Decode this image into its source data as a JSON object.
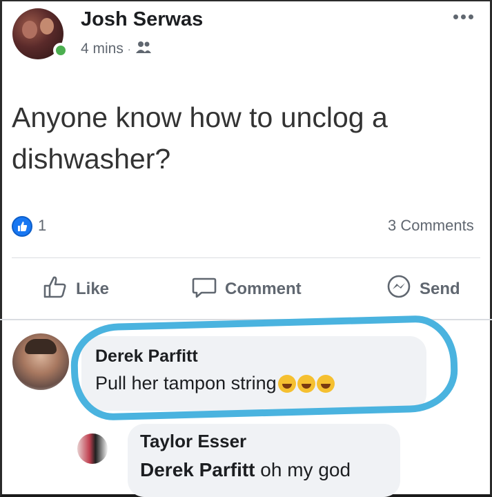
{
  "post": {
    "author": "Josh Serwas",
    "time": "4 mins",
    "separator": "·",
    "audience_icon": "friends-icon",
    "text": "Anyone know how to unclog a dishwasher?",
    "reaction_count": "1",
    "comments_count": "3 Comments"
  },
  "actions": {
    "like": "Like",
    "comment": "Comment",
    "send": "Send"
  },
  "comments": [
    {
      "name": "Derek Parfitt",
      "text": "Pull her tampon string",
      "emojis": [
        "laughing-emoji",
        "laughing-emoji",
        "laughing-emoji"
      ]
    },
    {
      "name": "Taylor Esser",
      "mention": "Derek Parfitt",
      "text": "oh my god"
    }
  ],
  "colors": {
    "like_blue": "#1877f2",
    "highlight": "#4ab3df",
    "online": "#4caf50",
    "bubble": "#f0f2f5"
  }
}
